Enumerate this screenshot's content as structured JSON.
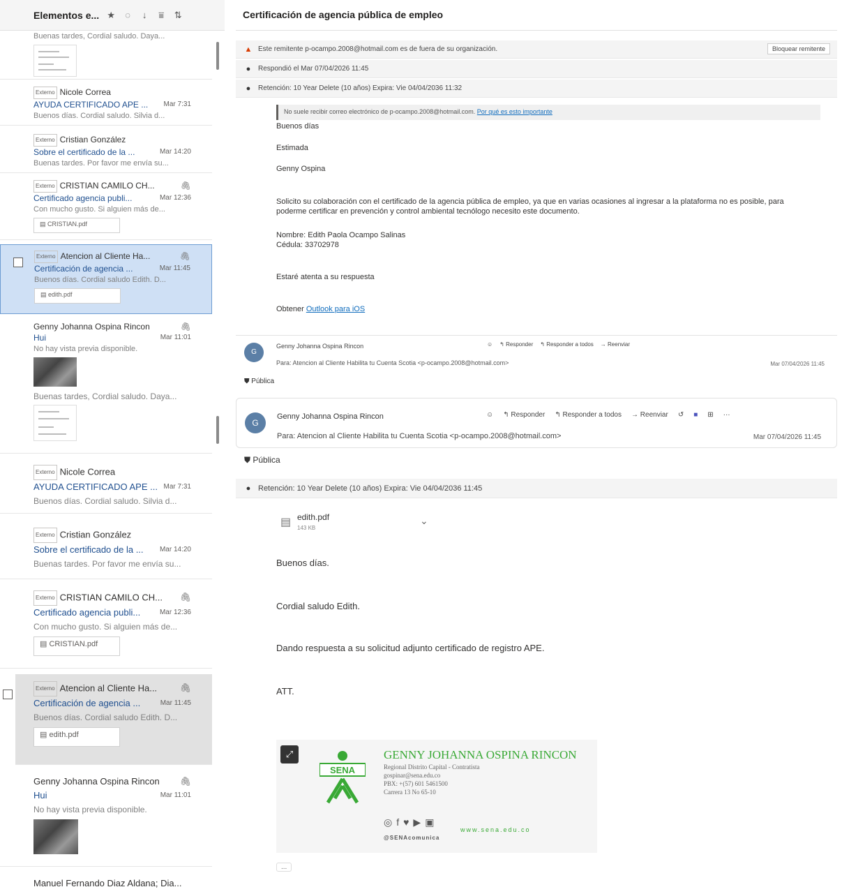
{
  "list": {
    "header_title": "Elementos e...",
    "items": [
      {
        "preview": "Buenas tardes, Cordial saludo. Daya..."
      },
      {
        "badge": "Externo",
        "sender": "Nicole Correa",
        "subject": "AYUDA CERTIFICADO APE ...",
        "time": "Mar 7:31",
        "preview": "Buenos días. Cordial saludo. Silvia d..."
      },
      {
        "badge": "Externo",
        "sender": "Cristian González",
        "subject": "Sobre el certificado de la ...",
        "time": "Mar 14:20",
        "preview": "Buenas tardes. Por favor me envía su..."
      },
      {
        "badge": "Externo",
        "sender": "CRISTIAN CAMILO CH...",
        "subject": "Certificado agencia publi...",
        "time": "Mar 12:36",
        "preview": "Con mucho gusto. Si alguien más de...",
        "attachment": "CRISTIAN.pdf"
      },
      {
        "badge": "Externo",
        "sender": "Atencion al Cliente Ha...",
        "subject": "Certificación de agencia ...",
        "time": "Mar 11:45",
        "preview": "Buenos días. Cordial saludo Edith. D...",
        "attachment": "edith.pdf"
      },
      {
        "sender": "Genny Johanna Ospina Rincon",
        "subject": "Hui",
        "time": "Mar 11:01",
        "preview": "No hay vista previa disponible."
      }
    ],
    "items2": [
      {
        "preview": "Buenas tardes, Cordial saludo. Daya..."
      },
      {
        "badge": "Externo",
        "sender": "Nicole Correa",
        "subject": "AYUDA CERTIFICADO APE ...",
        "time": "Mar 7:31",
        "preview": "Buenos días. Cordial saludo. Silvia d..."
      },
      {
        "badge": "Externo",
        "sender": "Cristian González",
        "subject": "Sobre el certificado de la ...",
        "time": "Mar 14:20",
        "preview": "Buenas tardes. Por favor me envía su..."
      },
      {
        "badge": "Externo",
        "sender": "CRISTIAN CAMILO CH...",
        "subject": "Certificado agencia publi...",
        "time": "Mar 12:36",
        "preview": "Con mucho gusto. Si alguien más de...",
        "attachment": "CRISTIAN.pdf"
      },
      {
        "badge": "Externo",
        "sender": "Atencion al Cliente Ha...",
        "subject": "Certificación de agencia ...",
        "time": "Mar 11:45",
        "preview": "Buenos días. Cordial saludo Edith. D...",
        "attachment": "edith.pdf"
      },
      {
        "sender": "Genny Johanna Ospina Rincon",
        "subject": "Hui",
        "time": "Mar 11:01",
        "preview": "No hay vista previa disponible."
      },
      {
        "sender": "Manuel Fernando Diaz Aldana; Dia..."
      }
    ]
  },
  "reader": {
    "subject": "Certificación de agencia pública de empleo",
    "external_warning": "Este remitente p-ocampo.2008@hotmail.com es de fuera de su organización.",
    "block_sender": "Bloquear remitente",
    "replied": "Respondió el Mar 07/04/2026 11:45",
    "retention1": "Retención: 10 Year Delete (10 años) Expira: Vie 04/04/2036 11:32",
    "ext_note": "No suele recibir correo electrónico de p-ocampo.2008@hotmail.com.",
    "ext_note_link": "Por qué es esto importante",
    "first_msg": {
      "greeting": "Buenos días",
      "dear": "Estimada",
      "name": "Genny Ospina",
      "body": "Solicito su colaboración con el certificado de la agencia pública de empleo, ya que en varias ocasiones al ingresar a la plataforma no es posible, para poderme certificar en prevención y control ambiental tecnólogo necesito este documento.",
      "nombre": "Nombre: Edith Paola Ocampo Salinas",
      "cedula": "Cédula: 33702978",
      "closing": "Estaré atenta a su respuesta",
      "obtener": "Obtener",
      "outlook_link": "Outlook para iOS"
    },
    "reply_hdr_small": {
      "sender": "Genny Johanna Ospina Rincon",
      "to_label": "Para:",
      "to": "Atencion al Cliente Habilita tu Cuenta Scotia <p-ocampo.2008@hotmail.com>",
      "date": "Mar 07/04/2026 11:45",
      "public": "Pública"
    },
    "actions": {
      "reply": "Responder",
      "reply_all": "Responder a todos",
      "forward": "Reenviar"
    },
    "reply": {
      "avatar": "G",
      "sender": "Genny Johanna Ospina Rincon",
      "to_label": "Para:",
      "to": "Atencion al Cliente Habilita tu Cuenta Scotia <p-ocampo.2008@hotmail.com>",
      "date": "Mar 07/04/2026 11:45",
      "public": "Pública",
      "retention": "Retención: 10 Year Delete (10 años) Expira: Vie 04/04/2036 11:45",
      "attachment": "edith.pdf",
      "attachment_size": "143 KB",
      "greeting": "Buenos días.",
      "saludo": "Cordial saludo Edith.",
      "body": "Dando respuesta a su solicitud adjunto certificado de registro APE.",
      "att": "ATT.",
      "more": "..."
    },
    "signature": {
      "logo_text": "SENA",
      "name": "GENNY JOHANNA OSPINA RINCON",
      "line1": "Regional Distrito Capital - Contratista",
      "line2": "gospinar@sena.edu.co",
      "line3": "PBX: +(57) 601 5461500",
      "line4": "Carrera 13 No 65-10",
      "web": "www.sena.edu.co",
      "handle": "@SENAcomunica"
    }
  }
}
